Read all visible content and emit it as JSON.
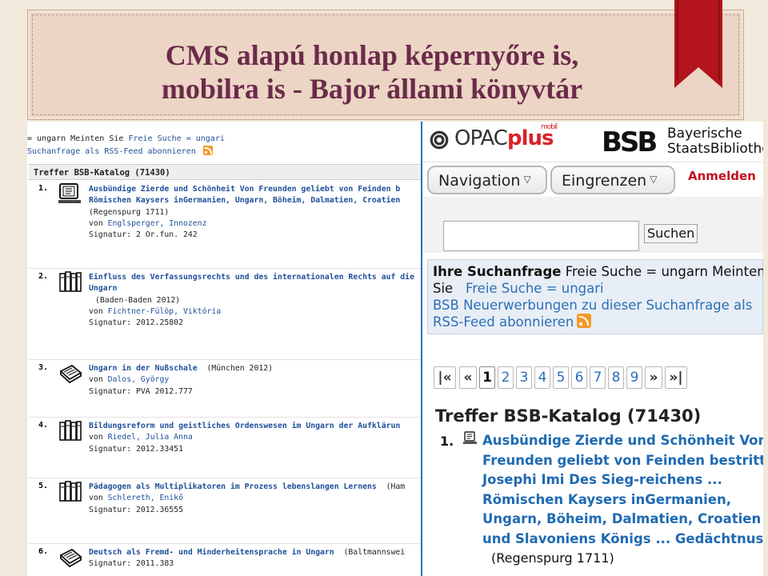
{
  "slide": {
    "title_line1": "CMS alapú honlap képernyőre is,",
    "title_line2": "mobilra is - Bajor állami könyvtár"
  },
  "desktop": {
    "query_prefix": "= ungarn Meinten Sie",
    "query_link": "Freie Suche = ungari",
    "rss_link": "Suchanfrage als RSS-Feed abonnieren",
    "results_header": "Treffer BSB-Katalog (71430)",
    "hits": [
      {
        "num": "1.",
        "icon": "ebook-icon",
        "title1": "Ausbündige Zierde und Schönheit Von Freunden geliebt von Feinden b",
        "title2": "Römischen Kaysers inGermanien, Ungarn, Böheim, Dalmatien, Croatien",
        "pub": "(Regenspurg 1711)",
        "by": "von",
        "author": "Englsperger, Innozenz",
        "sig": "Signatur: 2 Or.fun. 242"
      },
      {
        "num": "2.",
        "icon": "books-icon",
        "title1": "Einfluss des Verfassungsrechts und des internationalen Rechts auf die",
        "title2": "Ungarn",
        "pub": "(Baden-Baden 2012)",
        "by": "von",
        "author": "Fichtner-Fülöp, Viktória",
        "sig": "Signatur: 2012.25802"
      },
      {
        "num": "3.",
        "icon": "book-icon",
        "title1": "Ungarn in der Nußschale",
        "pub_inline": "(München 2012)",
        "by": "von",
        "author": "Dalos, György",
        "sig": "Signatur: PVA 2012.777"
      },
      {
        "num": "4.",
        "icon": "books-icon",
        "title1": "Bildungsreform und geistliches Ordenswesen im Ungarn der Aufklärun",
        "by": "von",
        "author": "Riedel, Julia Anna",
        "sig": "Signatur: 2012.33451"
      },
      {
        "num": "5.",
        "icon": "books-icon",
        "title1": "Pädagogen als Multiplikatoren im Prozess lebenslangen Lernens",
        "pub_inline": "(Ham",
        "by": "von",
        "author": "Schlereth, Enikő",
        "sig": "Signatur: 2012.36555"
      },
      {
        "num": "6.",
        "icon": "book-icon",
        "title1": "Deutsch als Fremd- und Minderheitensprache in Ungarn",
        "pub_inline": "(Baltmannswei",
        "sig": "Signatur: 2011.383"
      }
    ]
  },
  "mobile": {
    "logo_opac": "OPAC",
    "logo_plus": "plus",
    "logo_mobil": "mobil",
    "bsb_mark": "BSB",
    "bsb_name1": "Bayerische",
    "bsb_name2": "StaatsBibliothek",
    "nav_navigation": "Navigation",
    "nav_eingrenzen": "Eingrenzen",
    "nav_login": "Anmelden",
    "search_button": "Suchen",
    "query_label": "Ihre Suchanfrage",
    "query_text": "Freie Suche = ungarn Meinten",
    "query_sie": "Sie",
    "query_link": "Freie Suche = ungari",
    "rss_link1": "BSB Neuerwerbungen zu dieser Suchanfrage als",
    "rss_link2": "RSS-Feed abonnieren",
    "pager": [
      "|«",
      "«",
      "1",
      "2",
      "3",
      "4",
      "5",
      "6",
      "7",
      "8",
      "9",
      "»",
      "»|"
    ],
    "results_header": "Treffer BSB-Katalog (71430)",
    "hit_num": "1.",
    "hit_lines": [
      "Ausbündige Zierde und Schönheit Von",
      "Freunden geliebt von Feinden bestritten",
      "Josephi Imi Des Sieg-reichens ...",
      "Römischen Kaysers inGermanien,",
      "Ungarn, Böheim, Dalmatien, Croatien",
      "und Slavoniens Königs ... Gedächtnus ..."
    ],
    "hit_pub": "(Regenspurg 1711)"
  }
}
